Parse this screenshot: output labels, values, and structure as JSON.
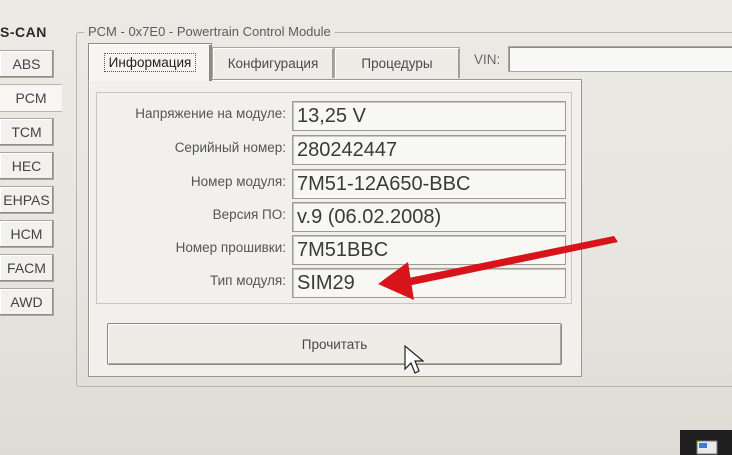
{
  "bus": {
    "title": "S-CAN",
    "modules": [
      {
        "label": "ABS",
        "active": false
      },
      {
        "label": "PCM",
        "active": true
      },
      {
        "label": "TCM",
        "active": false
      },
      {
        "label": "HEC",
        "active": false
      },
      {
        "label": "EHPAS",
        "active": false
      },
      {
        "label": "HCM",
        "active": false
      },
      {
        "label": "FACM",
        "active": false
      },
      {
        "label": "AWD",
        "active": false
      }
    ]
  },
  "module_panel": {
    "title": "PCM - 0x7E0 - Powertrain Control Module",
    "tabs": [
      {
        "label": "Информация",
        "active": true
      },
      {
        "label": "Конфигурация",
        "active": false
      },
      {
        "label": "Процедуры",
        "active": false
      }
    ],
    "vin_label": "VIN:",
    "vin_value": ""
  },
  "info": {
    "fields": [
      {
        "label": "Напряжение на модуле:",
        "value": "13,25 V"
      },
      {
        "label": "Серийный номер:",
        "value": "280242447"
      },
      {
        "label": "Номер модуля:",
        "value": "7M51-12A650-BBC"
      },
      {
        "label": "Версия ПО:",
        "value": "v.9 (06.02.2008)"
      },
      {
        "label": "Номер прошивки:",
        "value": "7M51BBC"
      },
      {
        "label": "Тип модуля:",
        "value": "SIM29"
      }
    ],
    "read_button": "Прочитать"
  },
  "colors": {
    "arrow": "#d8141a",
    "window_bg": "#eceae4"
  }
}
